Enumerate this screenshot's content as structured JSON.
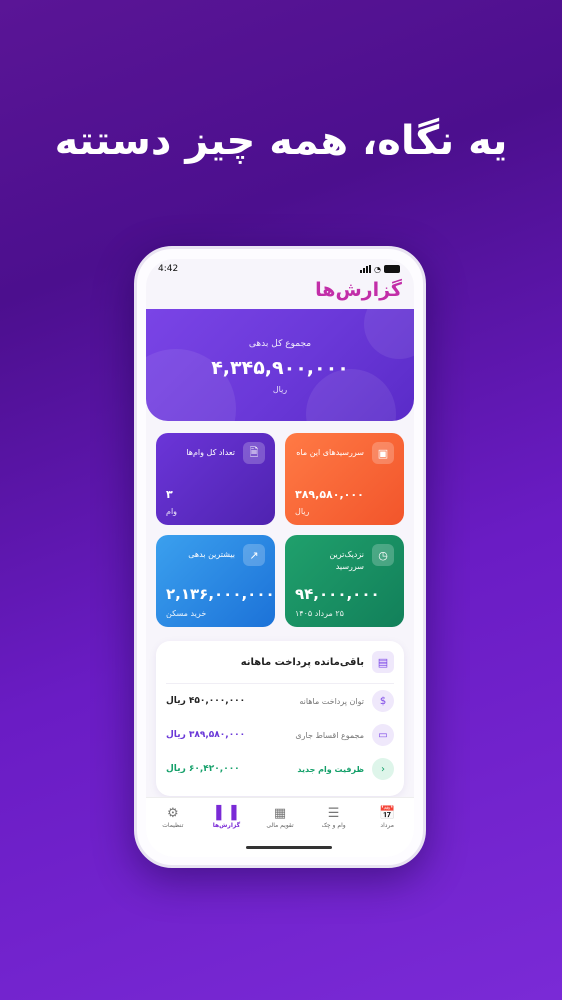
{
  "headline": "یه نگاه، همه چیز دستته",
  "status": {
    "time": "4:42"
  },
  "app": {
    "title": "گزارش‌ها"
  },
  "hero": {
    "label": "مجموع کل بدهی",
    "amount": "۴,۳۴۵,۹۰۰,۰۰۰",
    "currency": "ریال"
  },
  "cards": [
    {
      "title": "سررسیدهای این ماه",
      "value": "۳۸۹,۵۸۰,۰۰۰",
      "sub": "ریال",
      "icon": "wallet-icon",
      "color": "#f2552b"
    },
    {
      "title": "تعداد کل وام‌ها",
      "value": "۳",
      "sub": "وام",
      "icon": "document-icon",
      "color": "#5a2bc8"
    },
    {
      "title": "نزدیک‌ترین سررسید",
      "value": "۹۴,۰۰۰,۰۰۰",
      "sub": "۲۵ مرداد ۱۴۰۵",
      "icon": "calendar-icon",
      "color": "#12805a"
    },
    {
      "title": "بیشترین بدهی",
      "value": "۲,۱۳۶,۰۰۰,۰۰۰",
      "sub": "خرید مسکن",
      "icon": "trend-icon",
      "color": "#1c72d8"
    }
  ],
  "panel": {
    "title": "باقی‌مانده پرداخت ماهانه",
    "rows": [
      {
        "label": "توان پرداخت ماهانه",
        "value": "۴۵۰,۰۰۰,۰۰۰ ریال",
        "icon": "dollar-icon"
      },
      {
        "label": "مجموع اقساط جاری",
        "value": "۳۸۹,۵۸۰,۰۰۰ ریال",
        "icon": "card-icon"
      },
      {
        "label": "ظرفیت وام جدید",
        "value": "۶۰,۴۲۰,۰۰۰ ریال",
        "icon": "chevron-left-icon"
      }
    ]
  },
  "tabs": [
    {
      "label": "مرداد",
      "icon": "calendar-day-icon"
    },
    {
      "label": "وام و چک",
      "icon": "list-icon"
    },
    {
      "label": "تقویم مالی",
      "icon": "calendar-grid-icon"
    },
    {
      "label": "گزارش‌ها",
      "icon": "bar-chart-icon",
      "active": true
    },
    {
      "label": "تنظیمات",
      "icon": "gear-icon"
    }
  ],
  "colors": {
    "accent": "#7a2ad6",
    "brand": "#c22ea8"
  }
}
